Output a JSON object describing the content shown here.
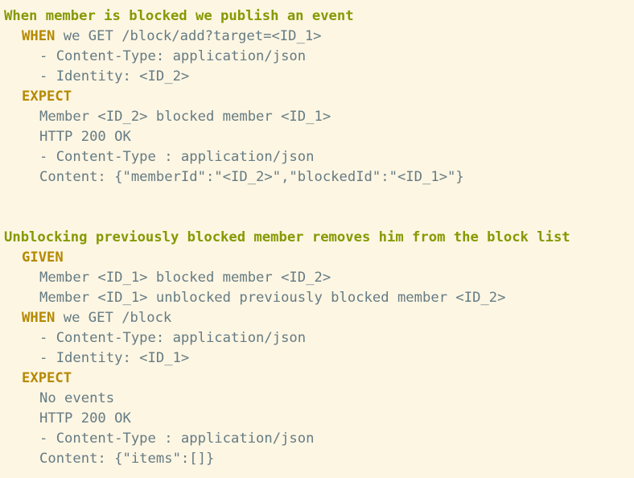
{
  "scenarios": [
    {
      "title": "When member is blocked we publish an event",
      "when_keyword": "WHEN",
      "when_rest": " we GET /block/add?target=<ID_1>",
      "when_items": [
        "- Content-Type: application/json",
        "- Identity: <ID_2>"
      ],
      "expect_keyword": "EXPECT",
      "expect_items": [
        "Member <ID_2> blocked member <ID_1>",
        "HTTP 200 OK",
        "- Content-Type : application/json",
        "Content: {\"memberId\":\"<ID_2>\",\"blockedId\":\"<ID_1>\"}"
      ]
    },
    {
      "title": "Unblocking previously blocked member removes him from the block list",
      "given_keyword": "GIVEN",
      "given_items": [
        "Member <ID_1> blocked member <ID_2>",
        "Member <ID_1> unblocked previously blocked member <ID_2>"
      ],
      "when_keyword": "WHEN",
      "when_rest": " we GET /block",
      "when_items": [
        "- Content-Type: application/json",
        "- Identity: <ID_1>"
      ],
      "expect_keyword": "EXPECT",
      "expect_items": [
        "No events",
        "HTTP 200 OK",
        "- Content-Type : application/json",
        "Content: {\"items\":[]}"
      ]
    }
  ]
}
